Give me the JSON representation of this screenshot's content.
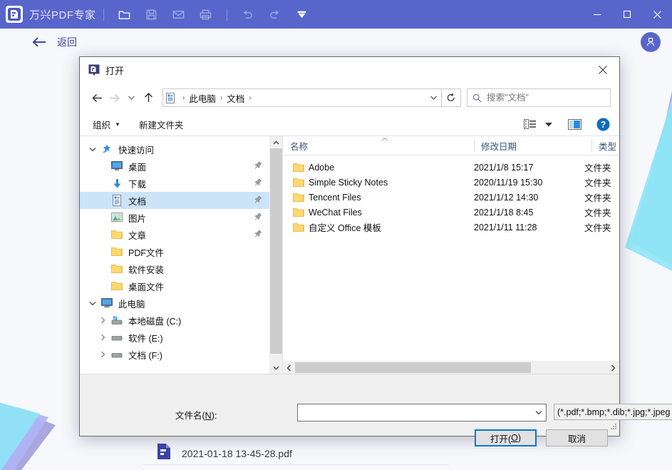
{
  "app": {
    "title": "万兴PDF专家",
    "logo_icon": "pdf-app-logo-icon",
    "toolbar": [
      {
        "name": "open-file-icon",
        "label": "打开",
        "dim": false
      },
      {
        "name": "save-file-icon",
        "label": "保存",
        "dim": true
      },
      {
        "name": "email-icon",
        "label": "邮件",
        "dim": true
      },
      {
        "name": "print-icon",
        "label": "打印",
        "dim": true
      }
    ],
    "toolbar2": [
      {
        "name": "undo-icon",
        "label": "撤销",
        "dim": true
      },
      {
        "name": "redo-icon",
        "label": "重做",
        "dim": true
      },
      {
        "name": "customize-toolbar-icon",
        "label": "更多",
        "dim": false
      }
    ],
    "window_controls": [
      {
        "name": "minimize-button",
        "glyph": "—"
      },
      {
        "name": "maximize-button",
        "glyph": "□"
      },
      {
        "name": "close-button",
        "glyph": "✕"
      }
    ],
    "back_label": "返回",
    "back_icon": "arrow-left-icon",
    "avatar_icon": "user-avatar-icon"
  },
  "recent_document": {
    "name": "2021-01-18 13-45-28.pdf",
    "icon": "pdf-file-icon"
  },
  "dialog": {
    "title": "打开",
    "icon": "pdf-app-logo-icon",
    "close_glyph": "✕",
    "nav": {
      "back_glyph": "←",
      "forward_glyph": "→",
      "recent_glyph": "⌄",
      "up_glyph": "↑",
      "path_icon": "documents-folder-icon",
      "breadcrumbs": [
        "此电脑",
        "文档"
      ],
      "separator": "›",
      "dropdown_glyph": "⌄",
      "refresh_glyph": "↻"
    },
    "search": {
      "icon": "search-icon",
      "placeholder": "搜索\"文档\"",
      "value": ""
    },
    "commandbar": {
      "organize_label": "组织",
      "organize_caret": "▼",
      "new_folder_label": "新建文件夹",
      "view_icon": "view-options-icon",
      "view_caret": "▼",
      "preview_pane_icon": "preview-pane-icon",
      "help_icon": "help-icon",
      "help_glyph": "?"
    },
    "sidebar": {
      "items": [
        {
          "label": "快速访问",
          "icon": "quick-access-star-icon",
          "indent": 0,
          "chevron": "⌄",
          "pinned": false,
          "selected": false
        },
        {
          "label": "桌面",
          "icon": "desktop-icon",
          "indent": 1,
          "chevron": "",
          "pinned": true,
          "selected": false
        },
        {
          "label": "下载",
          "icon": "downloads-icon",
          "indent": 1,
          "chevron": "",
          "pinned": true,
          "selected": false
        },
        {
          "label": "文档",
          "icon": "documents-icon",
          "indent": 1,
          "chevron": "",
          "pinned": true,
          "selected": true
        },
        {
          "label": "图片",
          "icon": "pictures-icon",
          "indent": 1,
          "chevron": "",
          "pinned": true,
          "selected": false
        },
        {
          "label": "文章",
          "icon": "folder-icon",
          "indent": 1,
          "chevron": "",
          "pinned": true,
          "selected": false
        },
        {
          "label": "PDF文件",
          "icon": "folder-icon",
          "indent": 1,
          "chevron": "",
          "pinned": false,
          "selected": false
        },
        {
          "label": "软件安装",
          "icon": "folder-icon",
          "indent": 1,
          "chevron": "",
          "pinned": false,
          "selected": false
        },
        {
          "label": "桌面文件",
          "icon": "folder-icon",
          "indent": 1,
          "chevron": "",
          "pinned": false,
          "selected": false
        },
        {
          "label": "此电脑",
          "icon": "this-pc-icon",
          "indent": 0,
          "chevron": "⌄",
          "pinned": false,
          "selected": false
        },
        {
          "label": "本地磁盘 (C:)",
          "icon": "system-drive-icon",
          "indent": 1,
          "chevron": "›",
          "pinned": false,
          "selected": false
        },
        {
          "label": "软件 (E:)",
          "icon": "drive-icon",
          "indent": 1,
          "chevron": "›",
          "pinned": false,
          "selected": false
        },
        {
          "label": "文档 (F:)",
          "icon": "drive-icon",
          "indent": 1,
          "chevron": "›",
          "pinned": false,
          "selected": false
        }
      ],
      "pin_icon": "pin-icon",
      "scroll_up_glyph": "⌃",
      "scroll_down_glyph": "⌄"
    },
    "filelist": {
      "columns": [
        "名称",
        "修改日期",
        "类型"
      ],
      "sort_indicator": "⌃",
      "rows": [
        {
          "icon": "folder-icon",
          "name": "Adobe",
          "date": "2021/1/8 15:17",
          "type": "文件夹"
        },
        {
          "icon": "folder-icon",
          "name": "Simple Sticky Notes",
          "date": "2020/11/19 15:30",
          "type": "文件夹"
        },
        {
          "icon": "folder-icon",
          "name": "Tencent Files",
          "date": "2021/1/12 14:30",
          "type": "文件夹"
        },
        {
          "icon": "folder-icon",
          "name": "WeChat Files",
          "date": "2021/1/18 8:45",
          "type": "文件夹"
        },
        {
          "icon": "folder-icon",
          "name": "自定义 Office 模板",
          "date": "2021/1/11 11:28",
          "type": "文件夹"
        }
      ],
      "hscroll_left_glyph": "‹",
      "hscroll_right_glyph": "›"
    },
    "footer": {
      "filename_label_pre": "文件名(",
      "filename_label_key": "N",
      "filename_label_post": "):",
      "filename_value": "",
      "filename_placeholder": "",
      "filename_caret": "⌄",
      "filter_value": "(*.pdf;*.bmp;*.dib;*.jpg;*.jpeg",
      "filter_caret": "⌄",
      "open_label_pre": "打开(",
      "open_label_key": "O",
      "open_label_post": ")",
      "cancel_label": "取消"
    }
  },
  "colors": {
    "brand_purple": "#5865cb",
    "accent_blue": "#0078d7",
    "selection_blue": "#cce4f7",
    "folder_yellow": "#ffd970",
    "bg": "#f7f8fc"
  }
}
